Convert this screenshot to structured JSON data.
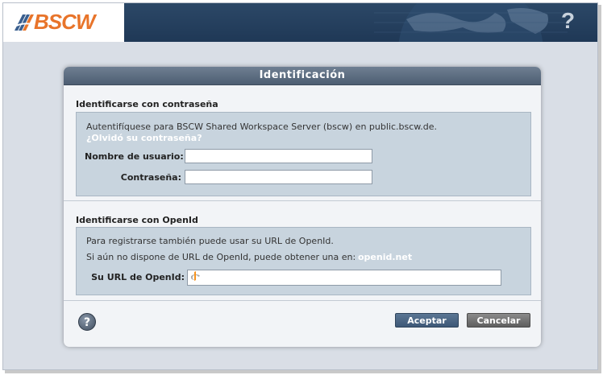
{
  "header": {
    "logo_text": "BSCW",
    "help_symbol": "?"
  },
  "dialog": {
    "title": "Identificación",
    "password_section": {
      "title": "Identificarse con contraseña",
      "info_text": "Autentifíquese para BSCW Shared Workspace Server (bscw) en public.bscw.de.",
      "forgot_link": "¿Olvidó su contraseña?",
      "username_label": "Nombre de usuario:",
      "username_value": "",
      "password_label": "Contraseña:",
      "password_value": ""
    },
    "openid_section": {
      "title": "Identificarse con OpenId",
      "info_line1": "Para registrarse también puede usar su URL de OpenId.",
      "info_line2": "Si aún no dispone de URL de OpenId, puede obtener una en:",
      "openid_link": "openid.net",
      "url_label": "Su URL de OpenId:",
      "url_value": ""
    },
    "buttons": {
      "help": "?",
      "accept": "Aceptar",
      "cancel": "Cancelar"
    }
  },
  "colors": {
    "header_bg": "#1f3856",
    "logo_orange": "#e8742a",
    "panel_bg": "#c8d4de",
    "accept_bg": "#3e5877",
    "cancel_bg": "#5f5f5f"
  }
}
